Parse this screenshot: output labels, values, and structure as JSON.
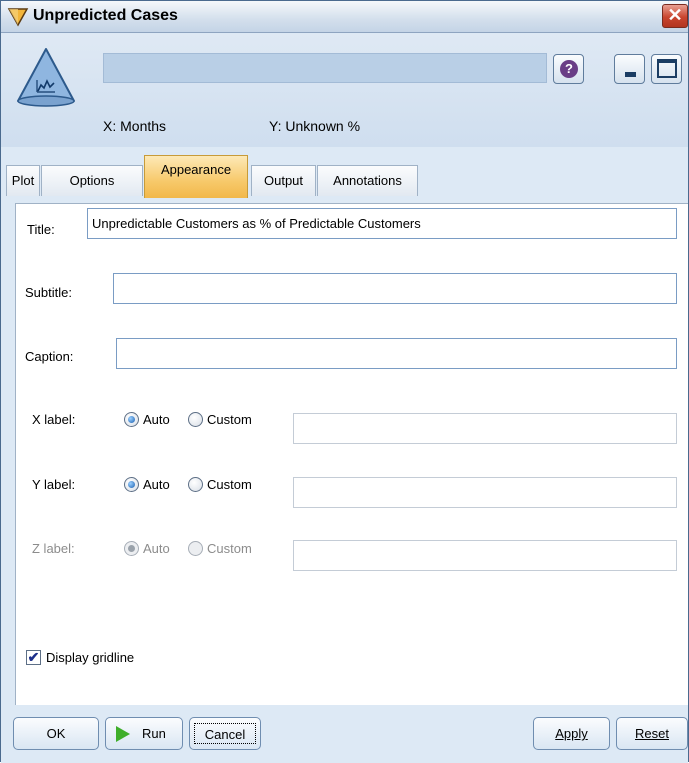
{
  "window": {
    "title": "Unpredicted Cases",
    "close_symbol": "✕",
    "app_icon": "diamond-node-icon"
  },
  "header": {
    "node_icon": "plot-node-icon",
    "name_value": "",
    "x_label": "X: Months",
    "y_label": "Y: Unknown %",
    "help_symbol": "?"
  },
  "tabs": [
    {
      "label": "Plot",
      "active": false
    },
    {
      "label": "Options",
      "active": false
    },
    {
      "label": "Appearance",
      "active": true
    },
    {
      "label": "Output",
      "active": false
    },
    {
      "label": "Annotations",
      "active": false
    }
  ],
  "appearance": {
    "title_label": "Title:",
    "title_value": "Unpredictable Customers as % of Predictable Customers",
    "subtitle_label": "Subtitle:",
    "subtitle_value": "",
    "caption_label": "Caption:",
    "caption_value": "",
    "x_label": {
      "label": "X label:",
      "selected": "Auto",
      "value": "",
      "enabled": true
    },
    "y_label": {
      "label": "Y label:",
      "selected": "Auto",
      "value": "",
      "enabled": true
    },
    "z_label": {
      "label": "Z label:",
      "selected": "Auto",
      "value": "",
      "enabled": false
    },
    "auto_option": "Auto",
    "custom_option": "Custom",
    "gridline_label": "Display gridline",
    "gridline_checked": true
  },
  "buttons": {
    "ok": "OK",
    "run": "Run",
    "cancel": "Cancel",
    "apply": "Apply",
    "reset": "Reset"
  }
}
